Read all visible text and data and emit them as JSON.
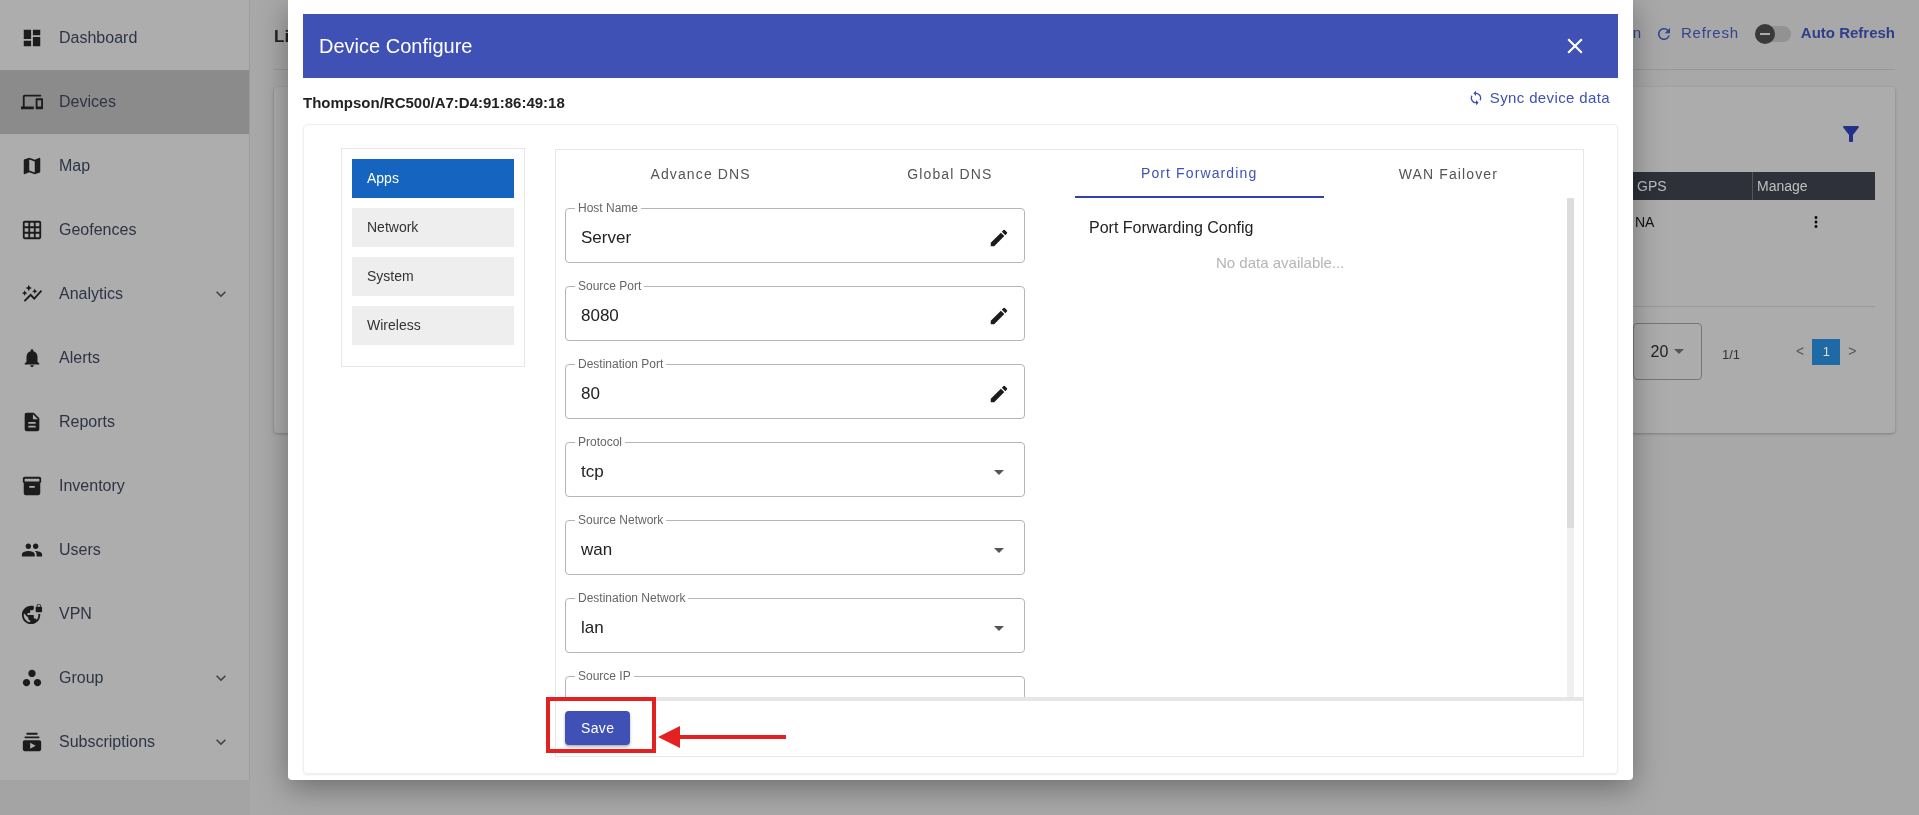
{
  "sidebar": {
    "items": [
      {
        "label": "Dashboard",
        "selected": false,
        "has_submenu": false
      },
      {
        "label": "Devices",
        "selected": true,
        "has_submenu": false
      },
      {
        "label": "Map",
        "selected": false,
        "has_submenu": false
      },
      {
        "label": "Geofences",
        "selected": false,
        "has_submenu": false
      },
      {
        "label": "Analytics",
        "selected": false,
        "has_submenu": true
      },
      {
        "label": "Alerts",
        "selected": false,
        "has_submenu": false
      },
      {
        "label": "Reports",
        "selected": false,
        "has_submenu": false
      },
      {
        "label": "Inventory",
        "selected": false,
        "has_submenu": false
      },
      {
        "label": "Users",
        "selected": false,
        "has_submenu": false
      },
      {
        "label": "VPN",
        "selected": false,
        "has_submenu": false
      },
      {
        "label": "Group",
        "selected": false,
        "has_submenu": true
      },
      {
        "label": "Subscriptions",
        "selected": false,
        "has_submenu": true
      }
    ]
  },
  "page": {
    "title": "Li",
    "toolbar": {
      "cut_label": "n",
      "refresh_label": "Refresh",
      "auto_refresh": {
        "label": "Auto Refresh",
        "on": false
      }
    },
    "table": {
      "columns": [
        "GPS",
        "Manage"
      ],
      "rows": [
        {
          "gps": "NA"
        }
      ]
    },
    "pagination": {
      "page_size": "20",
      "page_count": "1/1",
      "prev": "<",
      "next": ">",
      "pages": [
        {
          "label": "1",
          "selected": true
        }
      ]
    }
  },
  "dialog": {
    "title": "Device Configure",
    "device": "Thompson/RC500/A7:D4:91:86:49:18",
    "sync_label": "Sync device data",
    "menu": [
      {
        "label": "Apps",
        "selected": true
      },
      {
        "label": "Network",
        "selected": false
      },
      {
        "label": "System",
        "selected": false
      },
      {
        "label": "Wireless",
        "selected": false
      }
    ],
    "tabs": [
      {
        "label": "Advance DNS",
        "selected": false
      },
      {
        "label": "Global DNS",
        "selected": false
      },
      {
        "label": "Port Forwarding",
        "selected": true
      },
      {
        "label": "WAN Failover",
        "selected": false
      }
    ],
    "fields": [
      {
        "kind": "text",
        "label": "Host Name",
        "value": "Server"
      },
      {
        "kind": "text",
        "label": "Source Port",
        "value": "8080"
      },
      {
        "kind": "text",
        "label": "Destination Port",
        "value": "80"
      },
      {
        "kind": "select",
        "label": "Protocol",
        "value": "tcp"
      },
      {
        "kind": "select",
        "label": "Source Network",
        "value": "wan"
      },
      {
        "kind": "select",
        "label": "Destination Network",
        "value": "lan"
      },
      {
        "kind": "text",
        "label": "Source IP"
      }
    ],
    "panel_title": "Port Forwarding Config",
    "empty_text": "No data available...",
    "save_label": "Save"
  }
}
